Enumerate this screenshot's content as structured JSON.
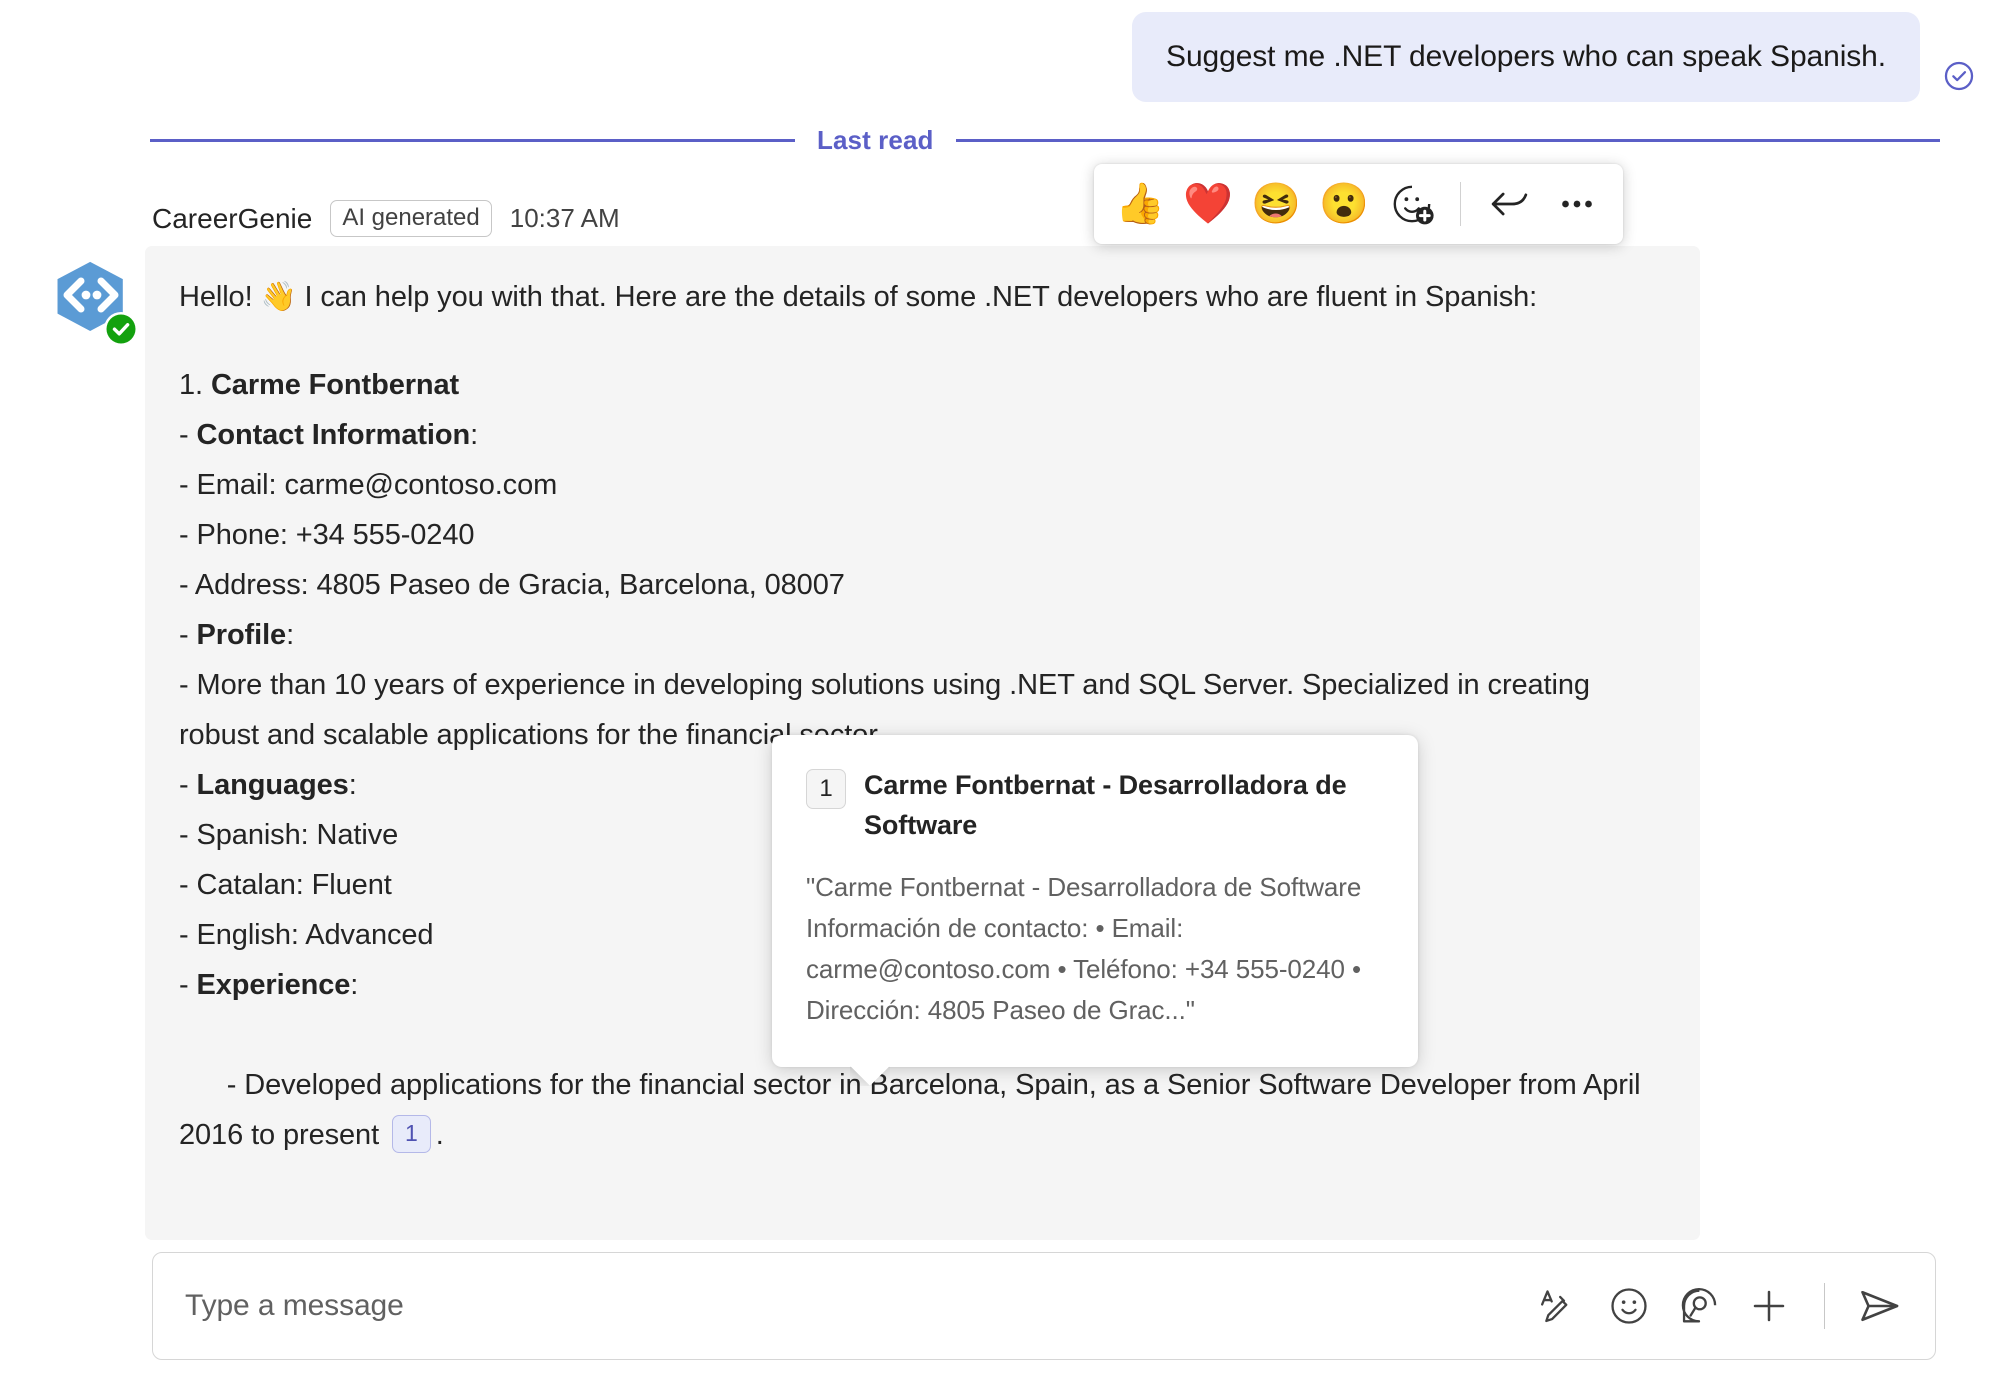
{
  "conversation": {
    "user_message": {
      "text": "Suggest me .NET developers who can speak Spanish.",
      "read_receipt_icon": "check-circle-icon"
    },
    "divider": {
      "label": "Last read",
      "color": "#5b5fc7"
    },
    "bot_message": {
      "sender": "CareerGenie",
      "ai_badge": "AI generated",
      "timestamp": "10:37 AM",
      "avatar_icon": "code-brackets-app-icon",
      "presence_icon": "available-check-icon",
      "intro": "Hello! 👋 I can help you with that. Here are the details of some .NET developers who are fluent in Spanish:",
      "lines": [
        {
          "prefix": "1. ",
          "bold": "Carme Fontbernat",
          "rest": ""
        },
        {
          "prefix": "- ",
          "bold": "Contact Information",
          "rest": ":"
        },
        {
          "prefix": "- ",
          "bold": "",
          "rest": "Email: carme@contoso.com"
        },
        {
          "prefix": "- ",
          "bold": "",
          "rest": "Phone: +34 555-0240"
        },
        {
          "prefix": "- ",
          "bold": "",
          "rest": "Address: 4805 Paseo de Gracia, Barcelona, 08007"
        },
        {
          "prefix": "- ",
          "bold": "Profile",
          "rest": ":"
        },
        {
          "prefix": "- ",
          "bold": "",
          "rest": "More than 10 years of experience in developing solutions using .NET and SQL Server. Specialized in creating robust and scalable applications for the financial sector."
        },
        {
          "prefix": "- ",
          "bold": "Languages",
          "rest": ":"
        },
        {
          "prefix": "- ",
          "bold": "",
          "rest": "Spanish: Native"
        },
        {
          "prefix": "- ",
          "bold": "",
          "rest": "Catalan: Fluent"
        },
        {
          "prefix": "- ",
          "bold": "",
          "rest": "English: Advanced"
        },
        {
          "prefix": "- ",
          "bold": "Experience",
          "rest": ":"
        }
      ],
      "final_line_before_citation": "- Developed applications for the financial sector in Barcelona, Spain, as a Senior Software Developer from April 2016 to present ",
      "citation_number": "1",
      "final_line_after_citation": "."
    }
  },
  "reaction_bar": {
    "buttons": [
      {
        "name": "reaction-thumbs-up",
        "glyph": "👍"
      },
      {
        "name": "reaction-heart",
        "glyph": "❤️"
      },
      {
        "name": "reaction-laugh",
        "glyph": "😆"
      },
      {
        "name": "reaction-surprised",
        "glyph": "😮"
      }
    ],
    "add_reaction_icon": "add-reaction-icon",
    "reply_icon": "reply-arrow-icon",
    "more_icon": "more-options-icon"
  },
  "citation_card": {
    "number": "1",
    "title": "Carme Fontbernat - Desarrolladora de Software",
    "body": "\"Carme Fontbernat - Desarrolladora de Software Información de contacto: • Email: carme@contoso.com • Teléfono: +34 555-0240 • Dirección: 4805 Paseo de Grac...\""
  },
  "composer": {
    "placeholder": "Type a message",
    "value": "",
    "tools": [
      {
        "name": "format-text-icon",
        "label": "Format"
      },
      {
        "name": "emoji-icon",
        "label": "Emoji"
      },
      {
        "name": "praise-icon",
        "label": "Praise"
      },
      {
        "name": "add-attachment-icon",
        "label": "More options"
      }
    ],
    "send_icon": "send-icon"
  },
  "colors": {
    "accent": "#5b5fc7",
    "user_bubble": "#e8ebfa",
    "bot_bubble": "#f5f5f5",
    "text": "#242424",
    "muted_text": "#616161"
  }
}
